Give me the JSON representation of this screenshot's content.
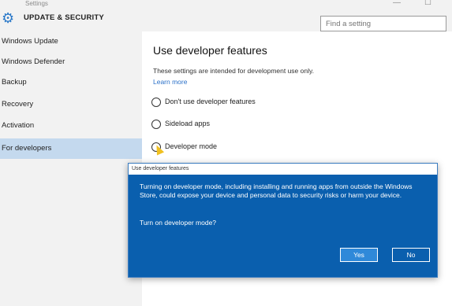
{
  "window": {
    "title": "Settings",
    "controls": {
      "minimize": "—",
      "maximize": "☐"
    }
  },
  "header": {
    "section_title": "UPDATE & SECURITY",
    "search_placeholder": "Find a setting"
  },
  "sidebar": {
    "items": [
      {
        "label": "Windows Update",
        "selected": false
      },
      {
        "label": "Windows Defender",
        "selected": false
      },
      {
        "label": "Backup",
        "selected": false
      },
      {
        "label": "Recovery",
        "selected": false
      },
      {
        "label": "Activation",
        "selected": false
      },
      {
        "label": "For developers",
        "selected": true
      }
    ]
  },
  "main": {
    "title": "Use developer features",
    "info": "These settings are intended for development use only.",
    "learn_more": "Learn more",
    "options": [
      {
        "label": "Don't use developer features",
        "selected": false
      },
      {
        "label": "Sideload apps",
        "selected": false
      },
      {
        "label": "Developer mode",
        "selected": false
      }
    ]
  },
  "dialog": {
    "title": "Use developer features",
    "message": "Turning on developer mode, including installing and running apps from outside the Windows Store, could expose your device and personal data to security risks or harm your device.",
    "question": "Turn on developer mode?",
    "yes_label": "Yes",
    "no_label": "No"
  },
  "colors": {
    "accent": "#0a5fae",
    "selected_nav": "#c4d9ee",
    "link": "#2a70c8"
  },
  "icons": {
    "settings": "gear-icon"
  }
}
